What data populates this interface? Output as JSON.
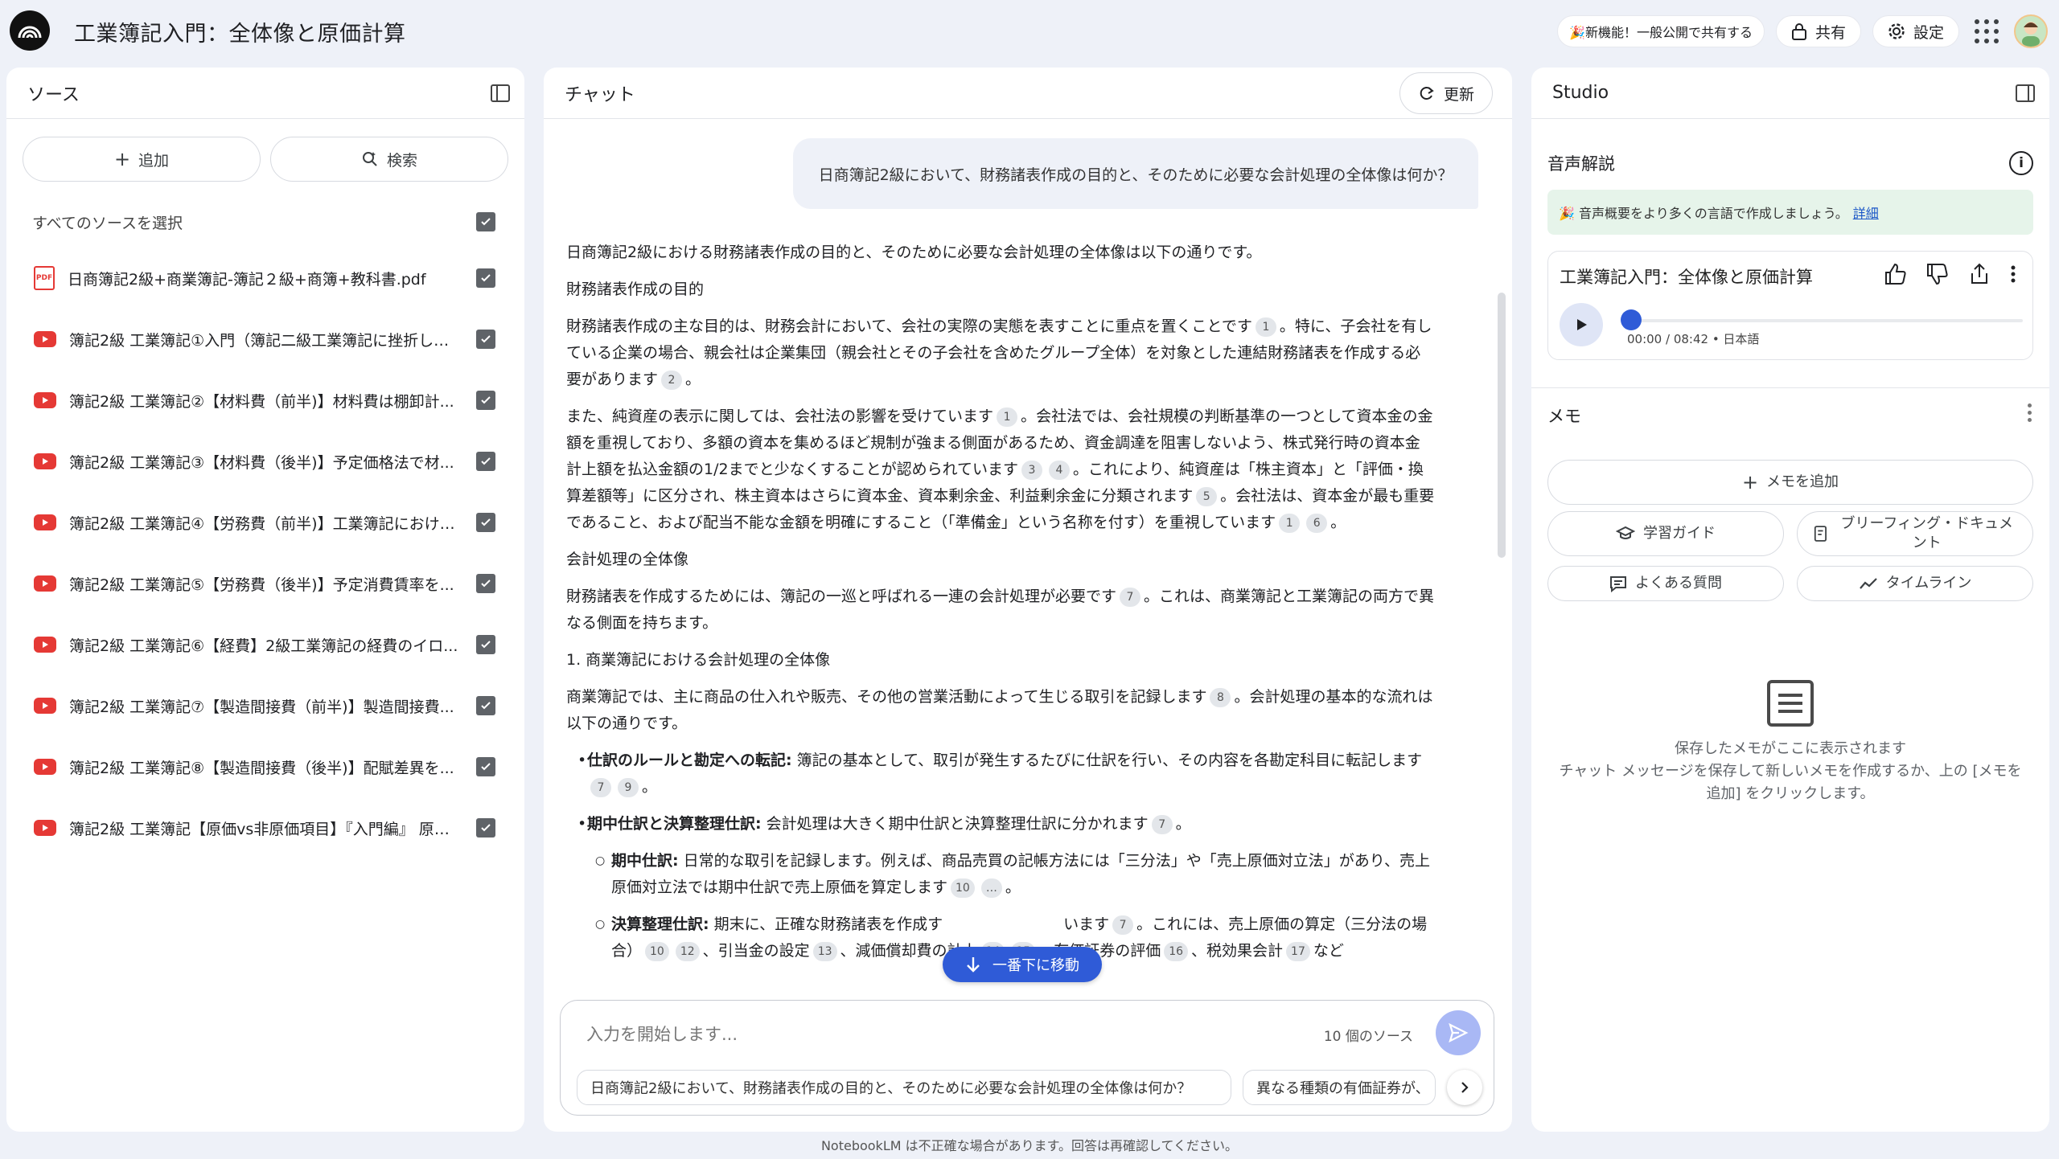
{
  "header": {
    "title": "工業簿記入門：全体像と原価計算",
    "new_feature": "🎉新機能！一般公開で共有する",
    "share": "共有",
    "settings": "設定"
  },
  "sources": {
    "title": "ソース",
    "add": "追加",
    "search": "検索",
    "select_all": "すべてのソースを選択",
    "items": [
      {
        "type": "pdf",
        "label": "日商簿記2級+商業簿記-簿記２級+商簿+教科書.pdf"
      },
      {
        "type": "youtube",
        "label": "簿記2級 工業簿記①入門（簿記二級工業簿記に挫折した..."
      },
      {
        "type": "youtube",
        "label": "簿記2級 工業簿記②【材料費（前半)】材料費は棚卸計..."
      },
      {
        "type": "youtube",
        "label": "簿記2級 工業簿記③【材料費（後半)】予定価格法で材..."
      },
      {
        "type": "youtube",
        "label": "簿記2級 工業簿記④【労務費（前半)】工業簿記における..."
      },
      {
        "type": "youtube",
        "label": "簿記2級 工業簿記⑤【労務費（後半)】予定消費賃率を..."
      },
      {
        "type": "youtube",
        "label": "簿記2級 工業簿記⑥【経費】2級工業簿記の経費のイロ..."
      },
      {
        "type": "youtube",
        "label": "簿記2級 工業簿記⑦【製造間接費（前半)】製造間接費..."
      },
      {
        "type": "youtube",
        "label": "簿記2級 工業簿記⑧【製造間接費（後半)】配賦差異を..."
      },
      {
        "type": "youtube",
        "label": "簿記2級 工業簿記【原価vs非原価項目】『入門編』 原価..."
      }
    ]
  },
  "chat": {
    "title": "チャット",
    "refresh": "更新",
    "user_message": "日商簿記2級において、財務諸表作成の目的と、そのために必要な会計処理の全体像は何か？",
    "a": {
      "intro": "日商簿記2級における財務諸表作成の目的と、そのために必要な会計処理の全体像は以下の通りです。",
      "h1": "財務諸表作成の目的",
      "p1a": "財務諸表作成の主な目的は、財務会計において、会社の実際の実態を表すことに重点を置くことです",
      "p1b": "。特に、子会社を有している企業の場合、親会社は企業集団（親会社とその子会社を含めたグループ全体）を対象とした連結財務諸表を作成する必要があります",
      "p2a": "また、純資産の表示に関しては、会社法の影響を受けています",
      "p2b": "。会社法では、会社規模の判断基準の一つとして資本金の金額を重視しており、多額の資本を集めるほど規制が強まる側面があるため、資金調達を阻害しないよう、株式発行時の資本金計上額を払込金額の1/2までと少なくすることが認められています",
      "p2c": "。これにより、純資産は「株主資本」と「評価・換算差額等」に区分され、株主資本はさらに資本金、資本剰余金、利益剰余金に分類されます",
      "p2d": "。会社法は、資本金が最も重要であること、および配当不能な金額を明確にすること（「準備金」という名称を付す）を重視しています",
      "h2": "会計処理の全体像",
      "p3a": "財務諸表を作成するためには、簿記の一巡と呼ばれる一連の会計処理が必要です",
      "p3b": "。これは、商業簿記と工業簿記の両方で異なる側面を持ちます。",
      "h3": "1. 商業簿記における会計処理の全体像",
      "p4a": "商業簿記では、主に商品の仕入れや販売、その他の営業活動によって生じる取引を記録します",
      "p4b": "。会計処理の基本的な流れは以下の通りです。",
      "b1t": "仕訳のルールと勘定への転記:",
      "b1": " 簿記の基本として、取引が発生するたびに仕訳を行い、その内容を各勘定科目に転記します",
      "b2t": "期中仕訳と決算整理仕訳:",
      "b2": " 会計処理は大きく期中仕訳と決算整理仕訳に分かれます",
      "s1t": "期中仕訳:",
      "s1": " 日常的な取引を記録します。例えば、商品売買の記帳方法には「三分法」や「売上原価対立法」があり、売上原価対立法では期中仕訳で売上原価を算定します",
      "s2t": "決算整理仕訳:",
      "s2a": " 期末に、正確な財務諸表を作成す",
      "s2b": "います",
      "s2c": "。これには、売上原価の算定（三分法の場合）",
      "s2d": "、引当金の設定",
      "s2e": "、減価償却費の計上",
      "s2f": "、有価証券の評価",
      "s2g": "、税効果会計",
      "s2h": "など",
      "c": [
        "1",
        "2",
        "1",
        "3",
        "4",
        "5",
        "1",
        "6",
        "7",
        "8",
        "7",
        "9",
        "7",
        "10",
        "…",
        "7",
        "10",
        "12",
        "13",
        "14",
        "15",
        "16",
        "17"
      ]
    },
    "scroll_bottom": "一番下に移動",
    "input_placeholder": "入力を開始します...",
    "source_count": "10 個のソース",
    "suggestions": [
      "日商簿記2級において、財務諸表作成の目的と、そのために必要な会計処理の全体像は何か？",
      "異なる種類の有価証券が、"
    ]
  },
  "studio": {
    "title": "Studio",
    "audio_title": "音声解説",
    "banner_text": "🎉 音声概要をより多くの言語で作成しましょう。",
    "banner_link": "詳細",
    "card_title": "工業簿記入門：全体像と原価計算",
    "audio_meta": "00:00 / 08:42 • 日本語",
    "audio_progress": 0.0,
    "memo_title": "メモ",
    "add_memo": "メモを追加",
    "study_guide": "学習ガイド",
    "briefing": "ブリーフィング・ドキュメント",
    "faq": "よくある質問",
    "timeline": "タイムライン",
    "empty_line1": "保存したメモがここに表示されます",
    "empty_line2": "チャット メッセージを保存して新しいメモを作成するか、上の [メモを追加] をクリックします。"
  },
  "footer": "NotebookLM は不正確な場合があります。回答は再確認してください。",
  "colors": {
    "accent": "#2f5bd7",
    "youtube": "#e53935",
    "banner": "#e6f4ea"
  }
}
